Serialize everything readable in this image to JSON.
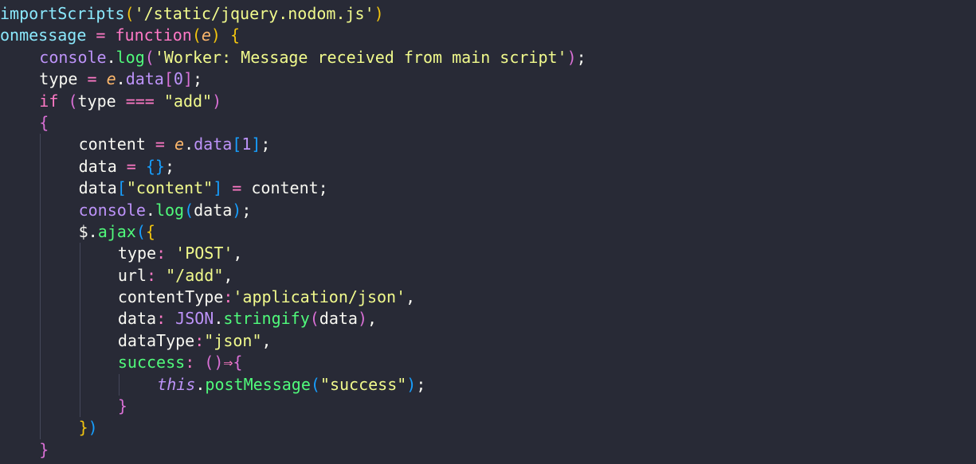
{
  "colors": {
    "background": "#282a36",
    "default": "#f8f8f2",
    "keyword": "#ff79c6",
    "function": "#50fa7b",
    "string": "#f1fa8c",
    "parameter": "#ffb86c",
    "builtin": "#8be9fd",
    "number": "#bd93f9",
    "bracket_gold": "#f1c40f",
    "bracket_magenta": "#da70d6",
    "bracket_blue": "#179fff",
    "indent_guide": "#44475a"
  },
  "editor": {
    "language": "javascript",
    "lines": [
      {
        "indent": 0,
        "tokens": [
          {
            "t": "importScripts",
            "c": "builtin"
          },
          {
            "t": "(",
            "c": "bracket_gold"
          },
          {
            "t": "'/static/jquery.nodom.js'",
            "c": "string"
          },
          {
            "t": ")",
            "c": "bracket_gold"
          }
        ]
      },
      {
        "indent": 0,
        "tokens": [
          {
            "t": "onmessage",
            "c": "builtin"
          },
          {
            "t": " = ",
            "c": "keyword"
          },
          {
            "t": "function",
            "c": "keyword"
          },
          {
            "t": "(",
            "c": "bracket_gold"
          },
          {
            "t": "e",
            "c": "parameter",
            "italic": true
          },
          {
            "t": ")",
            "c": "bracket_gold"
          },
          {
            "t": " ",
            "c": "default"
          },
          {
            "t": "{",
            "c": "bracket_gold"
          }
        ]
      },
      {
        "indent": 1,
        "tokens": [
          {
            "t": "console",
            "c": "number"
          },
          {
            "t": ".",
            "c": "default"
          },
          {
            "t": "log",
            "c": "function"
          },
          {
            "t": "(",
            "c": "bracket_magenta"
          },
          {
            "t": "'Worker: Message received from main script'",
            "c": "string"
          },
          {
            "t": ")",
            "c": "bracket_magenta"
          },
          {
            "t": ";",
            "c": "default"
          }
        ]
      },
      {
        "indent": 1,
        "tokens": [
          {
            "t": "type",
            "c": "default"
          },
          {
            "t": " = ",
            "c": "keyword"
          },
          {
            "t": "e",
            "c": "parameter",
            "italic": true
          },
          {
            "t": ".",
            "c": "default"
          },
          {
            "t": "data",
            "c": "number"
          },
          {
            "t": "[",
            "c": "bracket_magenta"
          },
          {
            "t": "0",
            "c": "number"
          },
          {
            "t": "]",
            "c": "bracket_magenta"
          },
          {
            "t": ";",
            "c": "default"
          }
        ]
      },
      {
        "indent": 1,
        "tokens": [
          {
            "t": "if",
            "c": "keyword"
          },
          {
            "t": " ",
            "c": "default"
          },
          {
            "t": "(",
            "c": "bracket_magenta"
          },
          {
            "t": "type",
            "c": "default"
          },
          {
            "t": " === ",
            "c": "keyword"
          },
          {
            "t": "\"add\"",
            "c": "string"
          },
          {
            "t": ")",
            "c": "bracket_magenta"
          }
        ]
      },
      {
        "indent": 1,
        "tokens": [
          {
            "t": "{",
            "c": "bracket_magenta"
          }
        ]
      },
      {
        "indent": 2,
        "tokens": [
          {
            "t": "content",
            "c": "default"
          },
          {
            "t": " = ",
            "c": "keyword"
          },
          {
            "t": "e",
            "c": "parameter",
            "italic": true
          },
          {
            "t": ".",
            "c": "default"
          },
          {
            "t": "data",
            "c": "number"
          },
          {
            "t": "[",
            "c": "bracket_blue"
          },
          {
            "t": "1",
            "c": "number"
          },
          {
            "t": "]",
            "c": "bracket_blue"
          },
          {
            "t": ";",
            "c": "default"
          }
        ]
      },
      {
        "indent": 2,
        "tokens": [
          {
            "t": "data",
            "c": "default"
          },
          {
            "t": " = ",
            "c": "keyword"
          },
          {
            "t": "{}",
            "c": "bracket_blue"
          },
          {
            "t": ";",
            "c": "default"
          }
        ]
      },
      {
        "indent": 2,
        "tokens": [
          {
            "t": "data",
            "c": "default"
          },
          {
            "t": "[",
            "c": "bracket_blue"
          },
          {
            "t": "\"content\"",
            "c": "string"
          },
          {
            "t": "]",
            "c": "bracket_blue"
          },
          {
            "t": " = ",
            "c": "keyword"
          },
          {
            "t": "content",
            "c": "default"
          },
          {
            "t": ";",
            "c": "default"
          }
        ]
      },
      {
        "indent": 2,
        "tokens": [
          {
            "t": "console",
            "c": "number"
          },
          {
            "t": ".",
            "c": "default"
          },
          {
            "t": "log",
            "c": "function"
          },
          {
            "t": "(",
            "c": "bracket_blue"
          },
          {
            "t": "data",
            "c": "default"
          },
          {
            "t": ")",
            "c": "bracket_blue"
          },
          {
            "t": ";",
            "c": "default"
          }
        ]
      },
      {
        "indent": 2,
        "tokens": [
          {
            "t": "$",
            "c": "default"
          },
          {
            "t": ".",
            "c": "default"
          },
          {
            "t": "ajax",
            "c": "function"
          },
          {
            "t": "(",
            "c": "bracket_blue"
          },
          {
            "t": "{",
            "c": "bracket_gold"
          }
        ]
      },
      {
        "indent": 3,
        "tokens": [
          {
            "t": "type",
            "c": "default"
          },
          {
            "t": ": ",
            "c": "keyword"
          },
          {
            "t": "'POST'",
            "c": "string"
          },
          {
            "t": ",",
            "c": "default"
          }
        ]
      },
      {
        "indent": 3,
        "tokens": [
          {
            "t": "url",
            "c": "default"
          },
          {
            "t": ": ",
            "c": "keyword"
          },
          {
            "t": "\"/add\"",
            "c": "string"
          },
          {
            "t": ",",
            "c": "default"
          }
        ]
      },
      {
        "indent": 3,
        "tokens": [
          {
            "t": "contentType",
            "c": "default"
          },
          {
            "t": ":",
            "c": "keyword"
          },
          {
            "t": "'application/json'",
            "c": "string"
          },
          {
            "t": ",",
            "c": "default"
          }
        ]
      },
      {
        "indent": 3,
        "tokens": [
          {
            "t": "data",
            "c": "default"
          },
          {
            "t": ": ",
            "c": "keyword"
          },
          {
            "t": "JSON",
            "c": "number"
          },
          {
            "t": ".",
            "c": "default"
          },
          {
            "t": "stringify",
            "c": "function"
          },
          {
            "t": "(",
            "c": "bracket_magenta"
          },
          {
            "t": "data",
            "c": "default"
          },
          {
            "t": ")",
            "c": "bracket_magenta"
          },
          {
            "t": ",",
            "c": "default"
          }
        ]
      },
      {
        "indent": 3,
        "tokens": [
          {
            "t": "dataType",
            "c": "default"
          },
          {
            "t": ":",
            "c": "keyword"
          },
          {
            "t": "\"json\"",
            "c": "string"
          },
          {
            "t": ",",
            "c": "default"
          }
        ]
      },
      {
        "indent": 3,
        "tokens": [
          {
            "t": "success",
            "c": "function"
          },
          {
            "t": ": ",
            "c": "keyword"
          },
          {
            "t": "()",
            "c": "bracket_magenta"
          },
          {
            "t": "⇒",
            "c": "keyword"
          },
          {
            "t": "{",
            "c": "bracket_magenta"
          }
        ]
      },
      {
        "indent": 4,
        "tokens": [
          {
            "t": "this",
            "c": "number",
            "italic": true
          },
          {
            "t": ".",
            "c": "default"
          },
          {
            "t": "postMessage",
            "c": "function"
          },
          {
            "t": "(",
            "c": "bracket_blue"
          },
          {
            "t": "\"success\"",
            "c": "string"
          },
          {
            "t": ")",
            "c": "bracket_blue"
          },
          {
            "t": ";",
            "c": "default"
          }
        ]
      },
      {
        "indent": 3,
        "tokens": [
          {
            "t": "}",
            "c": "bracket_magenta"
          }
        ]
      },
      {
        "indent": 2,
        "tokens": [
          {
            "t": "}",
            "c": "bracket_gold"
          },
          {
            "t": ")",
            "c": "bracket_blue"
          }
        ]
      },
      {
        "indent": 1,
        "tokens": [
          {
            "t": "}",
            "c": "bracket_magenta"
          }
        ]
      }
    ]
  }
}
